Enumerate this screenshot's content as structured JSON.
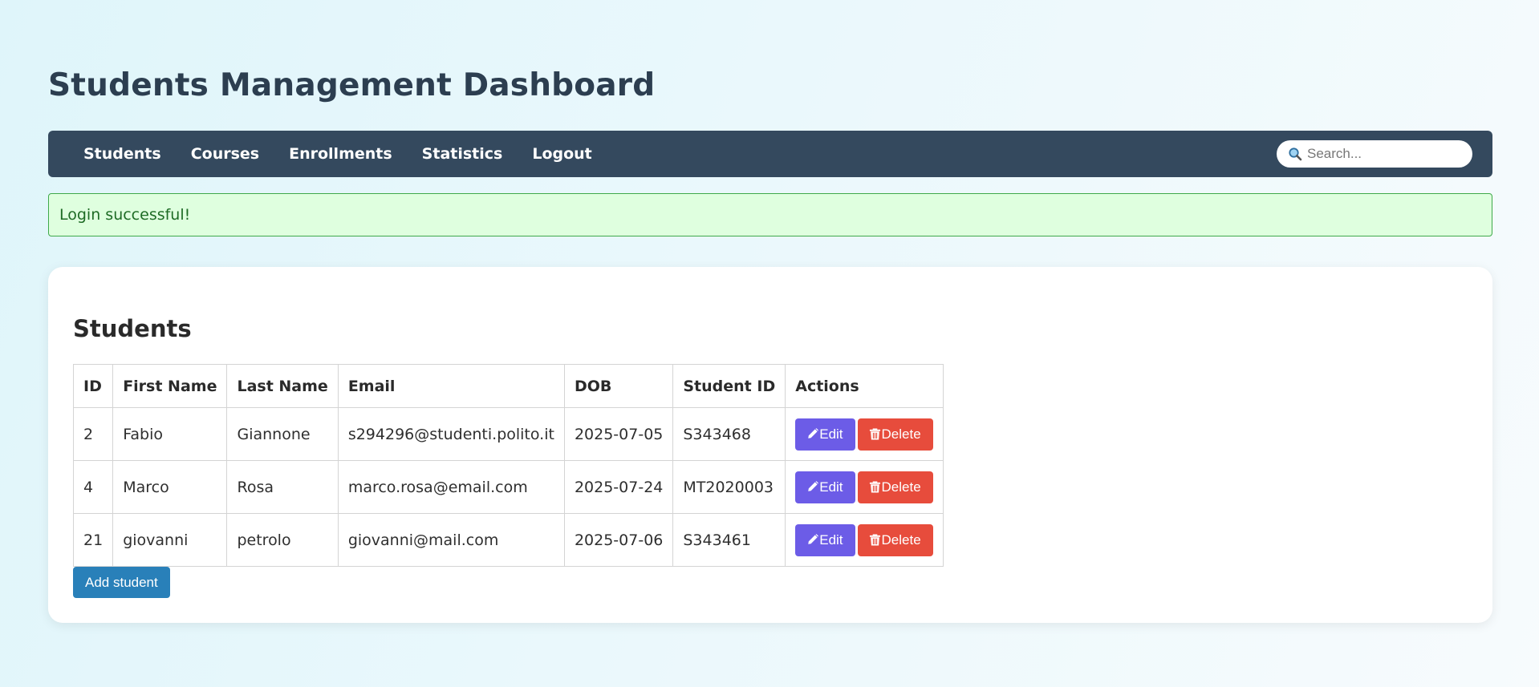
{
  "header": {
    "title": "Students Management Dashboard"
  },
  "nav": {
    "links": [
      {
        "label": "Students"
      },
      {
        "label": "Courses"
      },
      {
        "label": "Enrollments"
      },
      {
        "label": "Statistics"
      },
      {
        "label": "Logout"
      }
    ],
    "search": {
      "placeholder": "Search...",
      "icon": "search-icon"
    }
  },
  "alert": {
    "message": "Login successful!"
  },
  "students_panel": {
    "heading": "Students",
    "columns": [
      "ID",
      "First Name",
      "Last Name",
      "Email",
      "DOB",
      "Student ID",
      "Actions"
    ],
    "rows": [
      {
        "id": "2",
        "first_name": "Fabio",
        "last_name": "Giannone",
        "email": "s294296@studenti.polito.it",
        "dob": "2025-07-05",
        "student_id": "S343468"
      },
      {
        "id": "4",
        "first_name": "Marco",
        "last_name": "Rosa",
        "email": "marco.rosa@email.com",
        "dob": "2025-07-24",
        "student_id": "MT2020003"
      },
      {
        "id": "21",
        "first_name": "giovanni",
        "last_name": "petrolo",
        "email": "giovanni@mail.com",
        "dob": "2025-07-06",
        "student_id": "S343461"
      }
    ],
    "actions": {
      "edit_label": "Edit",
      "delete_label": "Delete",
      "edit_icon": "pencil-icon",
      "delete_icon": "trash-icon"
    },
    "add_label": "Add student"
  },
  "colors": {
    "navbar": "#34495e",
    "edit_button": "#6c5ce7",
    "delete_button": "#e74c3c",
    "add_button": "#2980b9",
    "alert_bg": "#dfffdf",
    "alert_border": "#3fa94a"
  }
}
